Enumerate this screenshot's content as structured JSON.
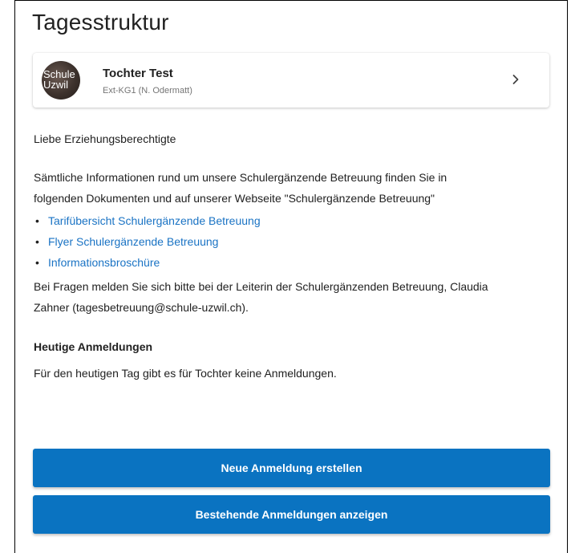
{
  "page": {
    "title": "Tagesstruktur"
  },
  "child": {
    "avatar_text": "Schule\nUzwil",
    "name": "Tochter Test",
    "class_info": "Ext-KG1 (N. Odermatt)",
    "chevron_icon": "chevron-right-icon"
  },
  "content": {
    "greeting": "Liebe Erziehungsberechtigte",
    "info_line1": "Sämtliche Informationen rund um unsere Schulergänzende Betreuung finden Sie in",
    "info_line2": "folgenden Dokumenten und auf unserer Webseite \"Schulergänzende Betreuung\"",
    "documents": [
      {
        "bullet": "•",
        "label": "Tarifübersicht Schulergänzende Betreuung"
      },
      {
        "bullet": "•",
        "label": "Flyer Schulergänzende Betreuung"
      },
      {
        "bullet": "•",
        "label": "Informationsbroschüre"
      }
    ],
    "contact_line1": "Bei Fragen melden Sie sich bitte bei der Leiterin der Schulergänzenden Betreuung, Claudia",
    "contact_line2": "Zahner (tagesbetreuung@schule-uzwil.ch)."
  },
  "today": {
    "heading": "Heutige Anmeldungen",
    "text": "Für den heutigen Tag gibt es für Tochter keine Anmeldungen."
  },
  "actions": {
    "new_label": "Neue Anmeldung erstellen",
    "existing_label": "Bestehende Anmeldungen anzeigen"
  },
  "colors": {
    "primary": "#0a73c1",
    "link": "#1a73c4",
    "text": "#212121",
    "muted": "#757575"
  }
}
